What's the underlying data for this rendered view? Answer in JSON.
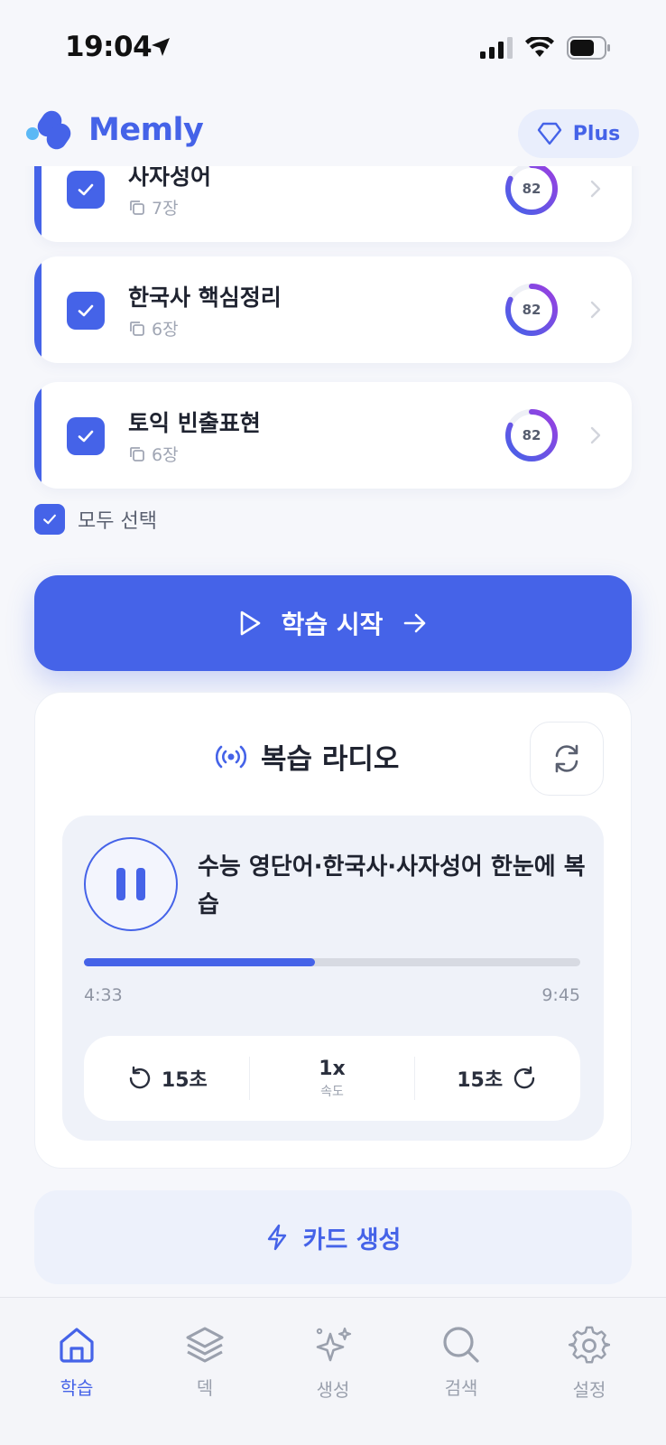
{
  "status_bar": {
    "time": "19:04"
  },
  "header": {
    "logo_text": "Memly",
    "plus_label": "Plus"
  },
  "decks": [
    {
      "title": "사자성어",
      "count": "7장",
      "score": "82",
      "progress": 0.82
    },
    {
      "title": "한국사 핵심정리",
      "count": "6장",
      "score": "82",
      "progress": 0.82
    },
    {
      "title": "토익 빈출표현",
      "count": "6장",
      "score": "82",
      "progress": 0.82
    }
  ],
  "select_all_label": "모두 선택",
  "start_button_label": "학습 시작",
  "radio": {
    "title": "복습 라디오",
    "track_title": "수능 영단어·한국사·사자성어 한눈에 복습",
    "current_time": "4:33",
    "total_time": "9:45",
    "progress": 0.466,
    "rewind_label": "15초",
    "speed_value": "1x",
    "speed_label": "속도",
    "forward_label": "15초"
  },
  "generate_button_label": "카드 생성",
  "tabs": [
    {
      "label": "학습",
      "icon": "home-icon",
      "active": true
    },
    {
      "label": "덱",
      "icon": "layers-icon",
      "active": false
    },
    {
      "label": "생성",
      "icon": "sparkles-icon",
      "active": false
    },
    {
      "label": "검색",
      "icon": "search-icon",
      "active": false
    },
    {
      "label": "설정",
      "icon": "gear-icon",
      "active": false
    }
  ],
  "colors": {
    "accent": "#4563e8",
    "ring_gradient_end": "#9a3fe0",
    "background": "#f6f7fb"
  }
}
